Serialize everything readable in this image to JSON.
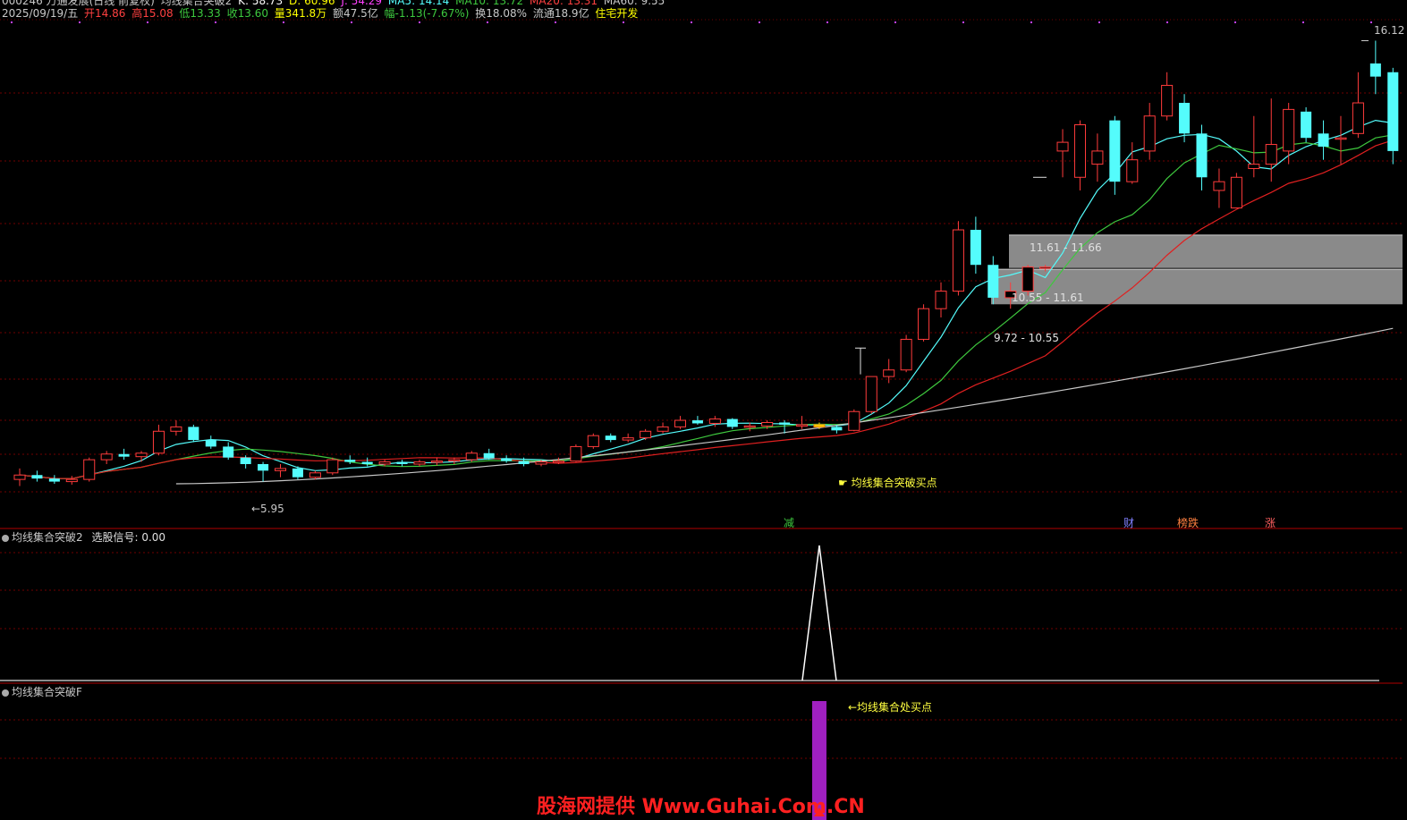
{
  "header": {
    "line1": {
      "code_name": "000246 万通发展(日线 前复权)",
      "indicator": "均线集合突破2",
      "k": "K: 58.73",
      "d": "D: 60.96",
      "j": "J: 54.29",
      "ma5": "MA5: 14.14",
      "ma10": "MA10: 13.72",
      "ma20": "MA20: 13.31",
      "ma60": "MA60: 9.55"
    },
    "line2": {
      "date": "2025/09/19/五",
      "open": "开14.86",
      "high": "高15.08",
      "low": "低13.33",
      "close": "收13.60",
      "volume": "量341.8万",
      "amount": "额47.5亿",
      "change": "幅-1.13(-7.67%)",
      "turnover": "换18.08%",
      "float": "流通18.9亿",
      "sector": "住宅开发"
    }
  },
  "annotations": {
    "price_low": "←5.95",
    "price_high": "16.12",
    "buy_point": "均线集合突破买点",
    "zone1": "11.61 - 11.66",
    "zone2": "10.55 - 11.61",
    "zone3": "9.72 - 10.55",
    "event_jian": "减",
    "event_cai": "财",
    "event_bang": "榜跌",
    "event_zhang": "涨"
  },
  "panel2": {
    "title": "均线集合突破2",
    "signal": "选股信号: 0.00"
  },
  "panel3": {
    "title": "均线集合突破F",
    "label": "←均线集合处买点"
  },
  "watermark": "股海网提供 Www.Guhai.Com.CN",
  "colors": {
    "up": "#ff3b3b",
    "down": "#54fcfc",
    "ma5": "#54fcfc",
    "ma10": "#3ec83e",
    "ma20": "#e02020",
    "ma60": "#c8c8c8",
    "signal_bar": "#a020c0",
    "highlight": "#ffe600"
  },
  "chart_data": {
    "type": "candlestick",
    "title": "",
    "yrange": [
      5.0,
      16.6
    ],
    "candles": [
      [
        6.1,
        6.35,
        5.95,
        6.2
      ],
      [
        6.2,
        6.3,
        6.05,
        6.12
      ],
      [
        6.12,
        6.2,
        6.0,
        6.05
      ],
      [
        6.05,
        6.18,
        5.98,
        6.1
      ],
      [
        6.1,
        6.6,
        6.05,
        6.55
      ],
      [
        6.55,
        6.75,
        6.45,
        6.68
      ],
      [
        6.68,
        6.8,
        6.55,
        6.62
      ],
      [
        6.62,
        6.75,
        6.5,
        6.7
      ],
      [
        6.7,
        7.35,
        6.65,
        7.2
      ],
      [
        7.2,
        7.45,
        7.1,
        7.3
      ],
      [
        7.3,
        7.35,
        6.95,
        7.0
      ],
      [
        7.0,
        7.1,
        6.8,
        6.85
      ],
      [
        6.85,
        6.95,
        6.55,
        6.6
      ],
      [
        6.6,
        6.65,
        6.35,
        6.45
      ],
      [
        6.45,
        6.5,
        6.05,
        6.3
      ],
      [
        6.3,
        6.45,
        6.15,
        6.35
      ],
      [
        6.35,
        6.4,
        6.1,
        6.15
      ],
      [
        6.15,
        6.3,
        6.1,
        6.25
      ],
      [
        6.25,
        6.6,
        6.2,
        6.55
      ],
      [
        6.55,
        6.65,
        6.45,
        6.5
      ],
      [
        6.5,
        6.6,
        6.4,
        6.45
      ],
      [
        6.45,
        6.55,
        6.4,
        6.5
      ],
      [
        6.5,
        6.55,
        6.4,
        6.45
      ],
      [
        6.45,
        6.55,
        6.4,
        6.5
      ],
      [
        6.5,
        6.6,
        6.42,
        6.52
      ],
      [
        6.52,
        6.6,
        6.45,
        6.55
      ],
      [
        6.55,
        6.75,
        6.5,
        6.7
      ],
      [
        6.7,
        6.8,
        6.55,
        6.58
      ],
      [
        6.58,
        6.65,
        6.48,
        6.52
      ],
      [
        6.52,
        6.6,
        6.4,
        6.45
      ],
      [
        6.45,
        6.55,
        6.4,
        6.5
      ],
      [
        6.5,
        6.6,
        6.45,
        6.52
      ],
      [
        6.52,
        6.9,
        6.5,
        6.85
      ],
      [
        6.85,
        7.15,
        6.8,
        7.1
      ],
      [
        7.1,
        7.15,
        6.95,
        7.0
      ],
      [
        7.0,
        7.15,
        6.95,
        7.05
      ],
      [
        7.05,
        7.25,
        7.0,
        7.2
      ],
      [
        7.2,
        7.4,
        7.15,
        7.3
      ],
      [
        7.3,
        7.55,
        7.25,
        7.45
      ],
      [
        7.45,
        7.55,
        7.35,
        7.38
      ],
      [
        7.38,
        7.55,
        7.3,
        7.48
      ],
      [
        7.48,
        7.5,
        7.25,
        7.3
      ],
      [
        7.3,
        7.4,
        7.2,
        7.32
      ],
      [
        7.32,
        7.45,
        7.25,
        7.4
      ],
      [
        7.4,
        7.45,
        7.15,
        7.35
      ],
      [
        7.35,
        7.55,
        7.25,
        7.35
      ],
      [
        7.35,
        7.4,
        7.25,
        7.3
      ],
      [
        7.3,
        7.35,
        7.15,
        7.22
      ],
      [
        7.22,
        7.7,
        7.2,
        7.65
      ],
      [
        7.65,
        8.45,
        7.6,
        8.45
      ],
      [
        8.45,
        8.85,
        8.3,
        8.6
      ],
      [
        8.6,
        9.4,
        8.55,
        9.3
      ],
      [
        9.3,
        10.1,
        9.25,
        10.0
      ],
      [
        10.0,
        10.6,
        9.8,
        10.4
      ],
      [
        10.4,
        12.0,
        10.3,
        11.8
      ],
      [
        11.8,
        12.1,
        10.8,
        11.0
      ],
      [
        11.0,
        11.2,
        10.1,
        10.25
      ],
      [
        10.25,
        10.6,
        10.0,
        10.4
      ],
      [
        10.4,
        11.0,
        10.3,
        10.95
      ],
      [
        10.95,
        11.0,
        10.85,
        10.95
      ],
      [
        13.6,
        14.1,
        13.0,
        13.8
      ],
      [
        13.0,
        14.3,
        12.7,
        14.2
      ],
      [
        13.3,
        14.0,
        12.9,
        13.6
      ],
      [
        14.3,
        14.4,
        12.6,
        12.9
      ],
      [
        12.9,
        13.8,
        12.85,
        13.4
      ],
      [
        13.6,
        14.7,
        13.4,
        14.4
      ],
      [
        14.4,
        15.4,
        14.3,
        15.1
      ],
      [
        14.7,
        14.9,
        13.8,
        14.0
      ],
      [
        14.0,
        14.2,
        12.7,
        13.0
      ],
      [
        12.7,
        13.2,
        12.3,
        12.9
      ],
      [
        12.3,
        13.1,
        12.3,
        13.0
      ],
      [
        13.2,
        14.4,
        13.0,
        13.3
      ],
      [
        13.3,
        14.8,
        12.9,
        13.75
      ],
      [
        13.6,
        14.7,
        13.3,
        14.55
      ],
      [
        14.5,
        14.6,
        13.8,
        13.9
      ],
      [
        14.0,
        14.3,
        13.4,
        13.7
      ],
      [
        13.9,
        14.4,
        13.3,
        13.9
      ],
      [
        14.0,
        15.4,
        13.9,
        14.7
      ],
      [
        15.6,
        16.12,
        14.9,
        15.3
      ],
      [
        15.4,
        15.5,
        13.3,
        13.6
      ]
    ],
    "ma60_start": 6.0,
    "ma60_end": 9.55,
    "signal_index": 46
  }
}
